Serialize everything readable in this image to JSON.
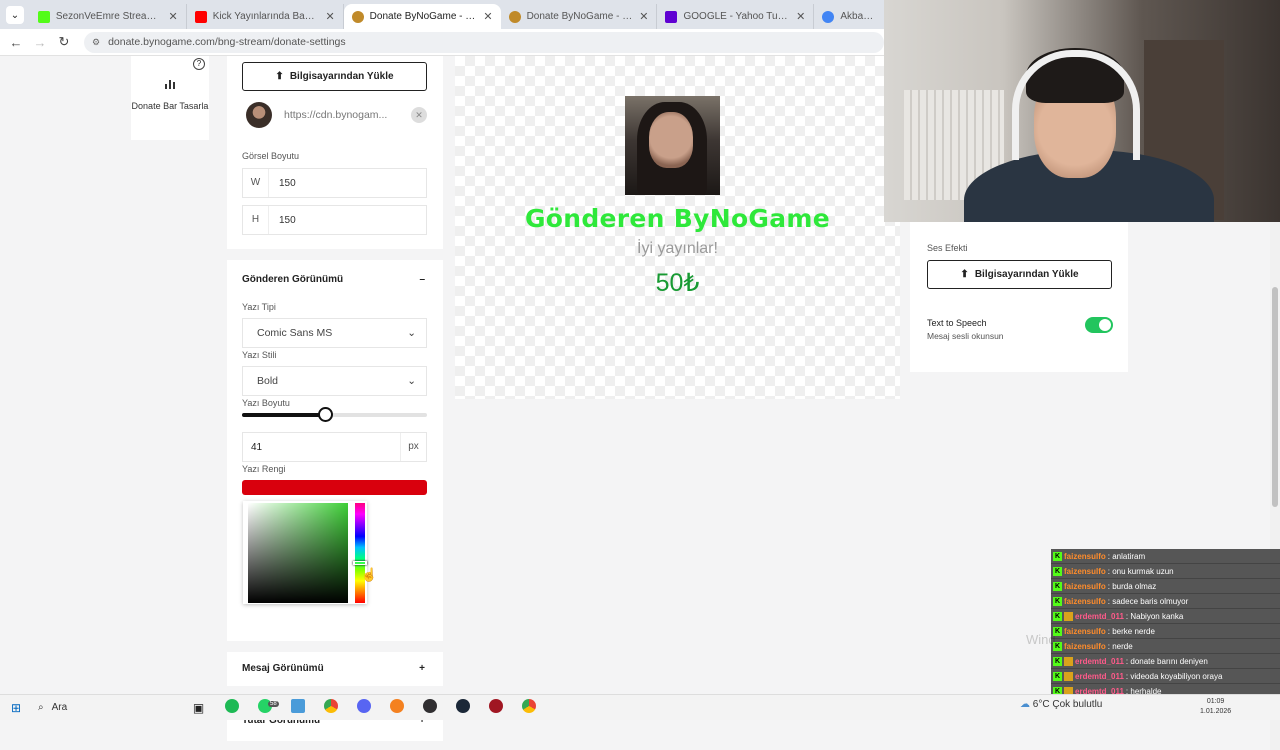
{
  "browser": {
    "tabs": [
      {
        "title": "SezonVeEmre Stream - Watch",
        "color": "#53fc18",
        "active": false
      },
      {
        "title": "Kick Yayınlarında Bağış Almanı",
        "color": "#ff0000",
        "active": false
      },
      {
        "title": "Donate ByNoGame - BNG Stre",
        "color": "#c08a2a",
        "active": true
      },
      {
        "title": "Donate ByNoGame - BNG Stre",
        "color": "#c08a2a",
        "active": false
      },
      {
        "title": "GOOGLE - Yahoo Turkey Ayan",
        "color": "#6001d2",
        "active": false
      },
      {
        "title": "Akbaba BEH",
        "color": "#4285f4",
        "active": false
      }
    ],
    "url": "donate.bynogame.com/bng-stream/donate-settings"
  },
  "sidebar": {
    "donate_bar_label": "Donate Bar Tasarla"
  },
  "image_settings": {
    "upload_label": "Bilgisayarından Yükle",
    "image_url": "https://cdn.bynogam...",
    "size_label": "Görsel Boyutu",
    "width_prefix": "W",
    "width": "150",
    "height_prefix": "H",
    "height": "150"
  },
  "sender_view": {
    "title": "Gönderen Görünümü",
    "toggle_symbol": "–",
    "font_label": "Yazı Tipi",
    "font_value": "Comic Sans MS",
    "style_label": "Yazı Stili",
    "style_value": "Bold",
    "size_label": "Yazı Boyutu",
    "size_value": "41",
    "size_unit": "px",
    "size_slider_fraction": 0.45,
    "color_label": "Yazı Rengi",
    "color_value": "#d9000d",
    "picker_hue": "#3ecf37"
  },
  "message_view": {
    "title": "Mesaj Görünümü",
    "toggle_symbol": "+"
  },
  "amount_view": {
    "title": "Tutar Görünümü",
    "toggle_symbol": "+"
  },
  "preview": {
    "sender": "Gönderen ByNoGame",
    "message": "İyi yayınlar!",
    "amount": "50₺",
    "sender_color": "#2ee83a",
    "amount_color": "#179a32"
  },
  "sound": {
    "label": "Ses Efekti",
    "upload_label": "Bilgisayarından Yükle",
    "tts_label": "Text to Speech",
    "tts_sub": "Mesaj sesli okunsun",
    "tts_enabled": true
  },
  "chat": [
    {
      "user": "faizensulfo",
      "msg": "anlatiram",
      "color": "orange",
      "badge": false
    },
    {
      "user": "faizensulfo",
      "msg": "onu kurmak uzun",
      "color": "orange",
      "badge": false
    },
    {
      "user": "faizensulfo",
      "msg": "burda olmaz",
      "color": "orange",
      "badge": false
    },
    {
      "user": "faizensulfo",
      "msg": "sadece baris olmuyor",
      "color": "orange",
      "badge": false
    },
    {
      "user": "erdemtd_011",
      "msg": "Nabiyon kanka",
      "color": "pink",
      "badge": true
    },
    {
      "user": "faizensulfo",
      "msg": "berke nerde",
      "color": "orange",
      "badge": false
    },
    {
      "user": "faizensulfo",
      "msg": "nerde",
      "color": "orange",
      "badge": false
    },
    {
      "user": "erdemtd_011",
      "msg": "donate barını deniyen",
      "color": "pink",
      "badge": true
    },
    {
      "user": "erdemtd_011",
      "msg": "videoda koyabiliyon oraya",
      "color": "pink",
      "badge": true
    },
    {
      "user": "erdemtd_011",
      "msg": "herhalde",
      "color": "pink",
      "badge": true
    }
  ],
  "overlay_watermark": "Wind",
  "taskbar": {
    "search_label": "Ara",
    "weather": "6°C Çok bulutlu",
    "time": "01:09",
    "date": "1.01.2026",
    "whatsapp_badge": "58"
  }
}
